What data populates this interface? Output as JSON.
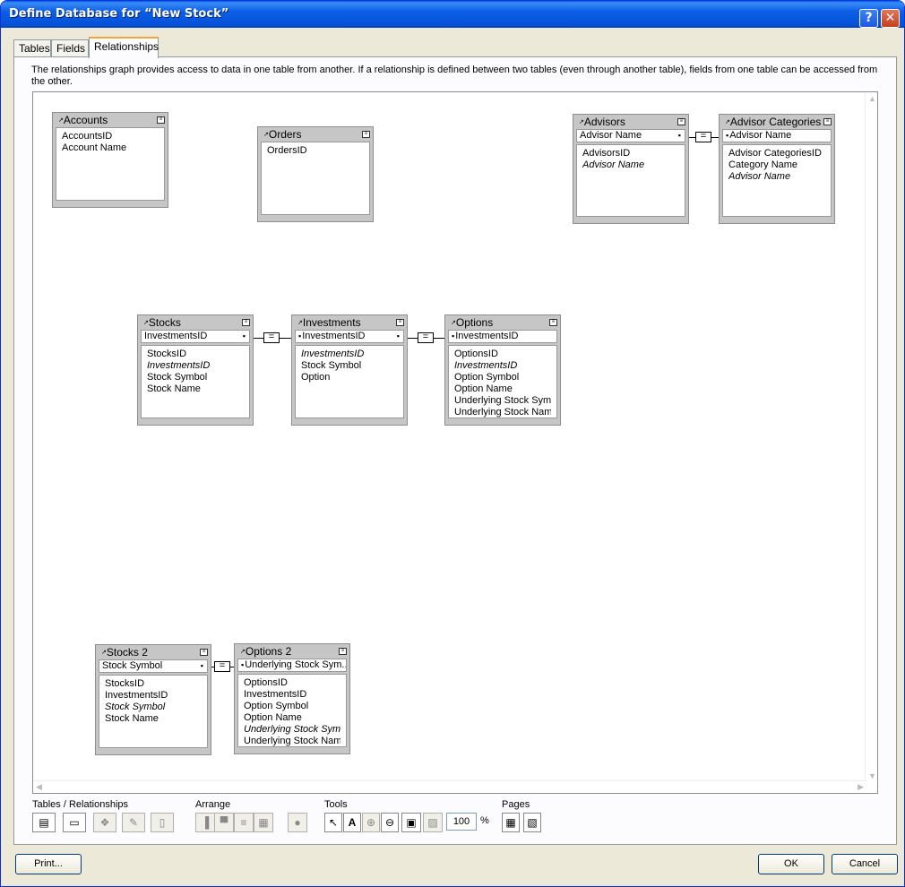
{
  "window": {
    "title": "Define Database for “New Stock”",
    "help_glyph": "?",
    "close_glyph": "✕"
  },
  "tabs": [
    {
      "label": "Tables"
    },
    {
      "label": "Fields"
    },
    {
      "label": "Relationships"
    }
  ],
  "description": "The relationships graph provides access to data in one table from another. If a relationship is defined between two tables (even through another table), fields from one table can be accessed from the other.",
  "tables": {
    "accounts": {
      "name": "Accounts",
      "fields": [
        "AccountsID",
        "Account Name"
      ]
    },
    "orders": {
      "name": "Orders",
      "fields": [
        "OrdersID"
      ]
    },
    "advisors": {
      "name": "Advisors",
      "key": "Advisor Name",
      "fields": [
        "AdvisorsID",
        "Advisor Name"
      ]
    },
    "advisor_categories": {
      "name": "Advisor Categories",
      "key": "Advisor Name",
      "fields": [
        "Advisor CategoriesID",
        "Category Name",
        "Advisor Name"
      ]
    },
    "stocks": {
      "name": "Stocks",
      "key": "InvestmentsID",
      "fields": [
        "StocksID",
        "InvestmentsID",
        "Stock Symbol",
        "Stock Name"
      ]
    },
    "investments": {
      "name": "Investments",
      "key": "InvestmentsID",
      "fields": [
        "InvestmentsID",
        "Stock Symbol",
        "Option"
      ]
    },
    "options": {
      "name": "Options",
      "key": "InvestmentsID",
      "fields": [
        "OptionsID",
        "InvestmentsID",
        "Option Symbol",
        "Option Name",
        "Underlying Stock Sym...",
        "Underlying Stock Name"
      ]
    },
    "stocks2": {
      "name": "Stocks 2",
      "key": "Stock Symbol",
      "fields": [
        "StocksID",
        "InvestmentsID",
        "Stock Symbol",
        "Stock Name"
      ]
    },
    "options2": {
      "name": "Options 2",
      "key": "Underlying Stock Sym...",
      "fields": [
        "OptionsID",
        "InvestmentsID",
        "Option Symbol",
        "Option Name",
        "Underlying Stock Sym...",
        "Underlying Stock Name"
      ]
    }
  },
  "relationship_operator": "=",
  "toolbar": {
    "group_tables": "Tables / Relationships",
    "group_arrange": "Arrange",
    "group_tools": "Tools",
    "group_pages": "Pages",
    "zoom_value": "100",
    "zoom_unit": "%"
  },
  "buttons": {
    "print": "Print...",
    "ok": "OK",
    "cancel": "Cancel"
  }
}
